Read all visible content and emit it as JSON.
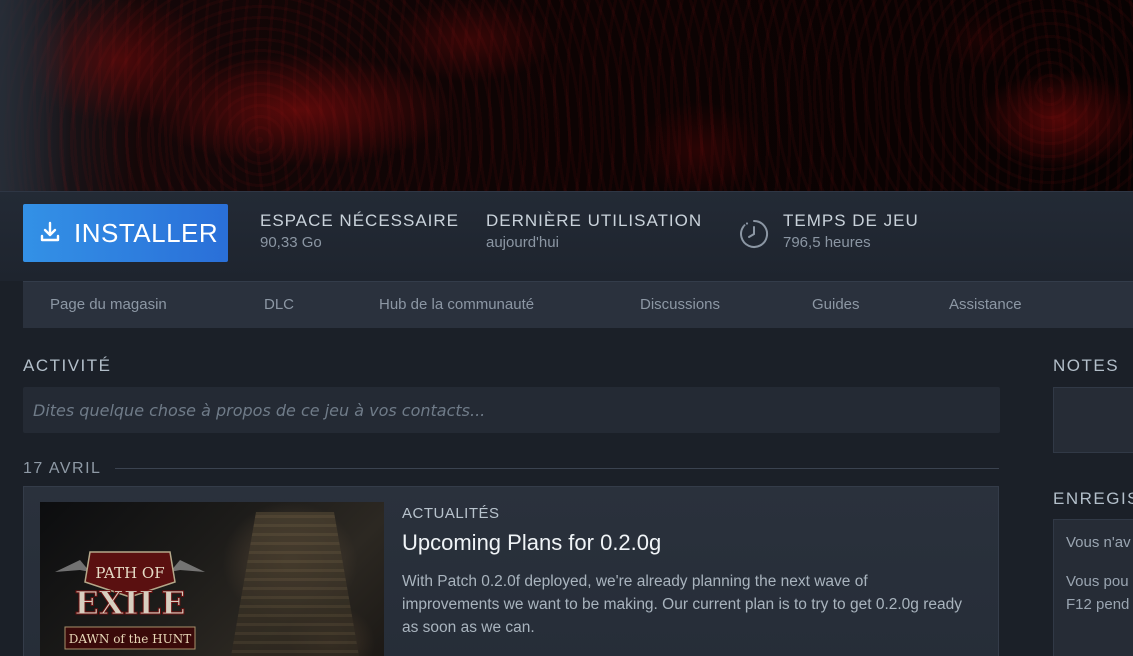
{
  "hero": {},
  "action_bar": {
    "install_label": "INSTALLER",
    "stats": [
      {
        "title": "ESPACE NÉCESSAIRE",
        "value": "90,33 Go"
      },
      {
        "title": "DERNIÈRE UTILISATION",
        "value": "aujourd'hui"
      },
      {
        "title": "TEMPS DE JEU",
        "value": "796,5 heures"
      }
    ]
  },
  "nav": {
    "items": [
      "Page du magasin",
      "DLC",
      "Hub de la communauté",
      "Discussions",
      "Guides",
      "Assistance"
    ]
  },
  "activity": {
    "title": "ACTIVITÉ",
    "placeholder": "Dites quelque chose à propos de ce jeu à vos contacts..."
  },
  "feed": {
    "date": "17 AVRIL",
    "news": {
      "thumbnail_logo": {
        "line1": "PATH OF",
        "line2": "EXILE",
        "line3": "DAWN of the HUNT"
      },
      "kicker": "ACTUALITÉS",
      "title": "Upcoming Plans for 0.2.0g",
      "body": "With Patch 0.2.0f deployed, we're already planning the next wave of improvements we want to be making. Our current plan is to try to get 0.2.0g ready as soon as we can."
    }
  },
  "sidebar": {
    "notes_title": "NOTES",
    "record_title": "ENREGIS",
    "record_line1": "Vous n'av",
    "record_line2a": "Vous pou",
    "record_line2b": "F12 pend"
  },
  "colors": {
    "install_blue": "#3391e6",
    "background": "#1b2028"
  }
}
